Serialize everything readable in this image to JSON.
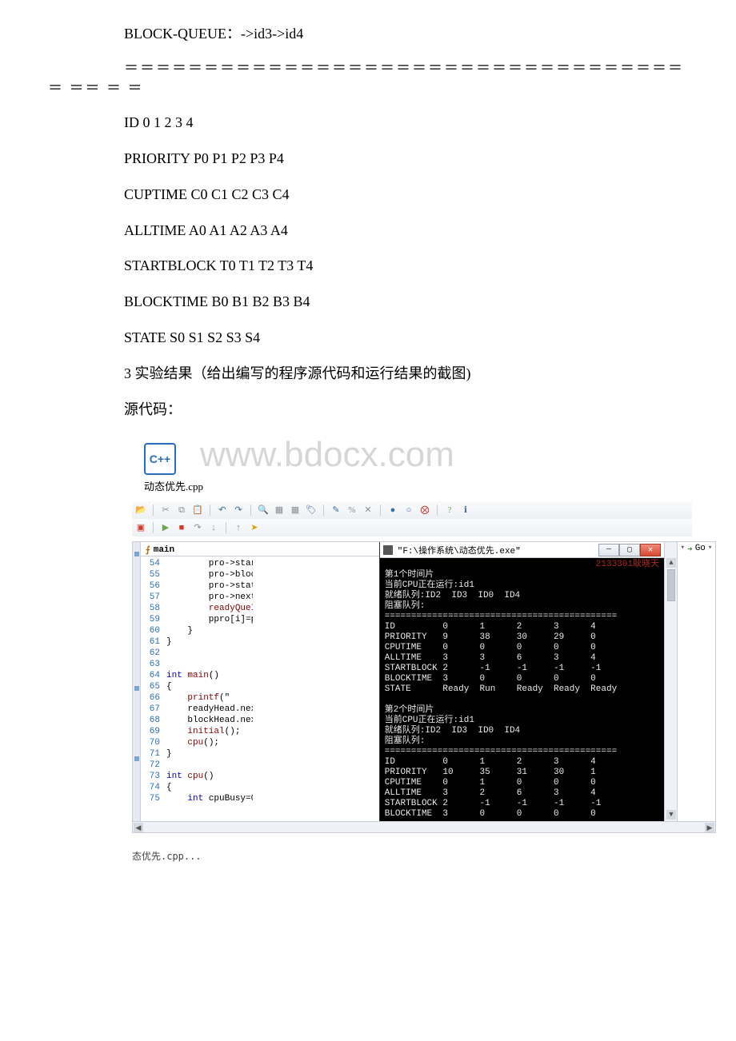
{
  "text": {
    "block_queue": "BLOCK-QUEUE：->id3->id4",
    "divider_head": "＝＝＝＝＝＝＝＝＝＝＝＝＝＝＝＝＝＝＝＝＝＝＝＝＝＝＝＝＝＝＝＝＝＝＝",
    "divider_tail": "＝ ＝＝ ＝ ＝",
    "id_row": "ID 0 1 2 3 4",
    "priority_row": "PRIORITY P0 P1 P2 P3 P4",
    "cuptime_row": "CUPTIME C0 C1 C2 C3 C4",
    "alltime_row": "ALLTIME A0 A1 A2 A3 A4",
    "startblock_row": "STARTBLOCK T0 T1 T2 T3 T4",
    "blocktime_row": "BLOCKTIME B0 B1 B2 B3 B4",
    "state_row": "STATE S0 S1 S2 S3 S4",
    "result_heading": "3 实验结果（给出编写的程序源代码和运行结果的截图)",
    "source_label": " 源代码：",
    "cpp_filename": "动态优先.cpp",
    "watermark": "www.bdocx.com",
    "footer_tab": "态优先.cpp..."
  },
  "ide": {
    "tab_label": "main",
    "go_label": "Go",
    "code": {
      "lines": [
        {
          "n": "54",
          "t": "        pro->star"
        },
        {
          "n": "55",
          "t": "        pro->bloc"
        },
        {
          "n": "56",
          "t": "        pro->stat"
        },
        {
          "n": "57",
          "t": "        pro->next"
        },
        {
          "n": "58",
          "t": "        readyQueI"
        },
        {
          "n": "59",
          "t": "        ppro[i]=p"
        },
        {
          "n": "60",
          "t": "    }"
        },
        {
          "n": "61",
          "t": "}"
        },
        {
          "n": "62",
          "t": ""
        },
        {
          "n": "63",
          "t": ""
        },
        {
          "n": "64",
          "t": "int main()"
        },
        {
          "n": "65",
          "t": "{"
        },
        {
          "n": "66",
          "t": "    printf(\""
        },
        {
          "n": "67",
          "t": "    readyHead.nex"
        },
        {
          "n": "68",
          "t": "    blockHead.nex"
        },
        {
          "n": "69",
          "t": "    initial();"
        },
        {
          "n": "70",
          "t": "    cpu();"
        },
        {
          "n": "71",
          "t": "}"
        },
        {
          "n": "72",
          "t": ""
        },
        {
          "n": "73",
          "t": "int cpu()"
        },
        {
          "n": "74",
          "t": "{"
        },
        {
          "n": "75",
          "t": "    int cpuBusy=0"
        }
      ]
    }
  },
  "console": {
    "title": "\"F:\\操作系统\\动态优先.exe\"",
    "student_id": "2133301耿晓天",
    "slice1": {
      "header": "第1个时间片",
      "running": "当前CPU正在运行:id1",
      "ready": "就绪队列:ID2  ID3  ID0  ID4",
      "block": "阻塞队列:",
      "sep": "============================================"
    },
    "slice2": {
      "header": "第2个时间片",
      "running": "当前CPU正在运行:id1",
      "ready": "就绪队列:ID2  ID3  ID0  ID4",
      "block": "阻塞队列:",
      "sep": "============================================"
    }
  },
  "chart_data": [
    {
      "type": "table",
      "title": "时间片1进程状态表",
      "columns": [
        "ID",
        "0",
        "1",
        "2",
        "3",
        "4"
      ],
      "rows": [
        [
          "PRIORITY",
          9,
          38,
          30,
          29,
          0
        ],
        [
          "CPUTIME",
          0,
          0,
          0,
          0,
          0
        ],
        [
          "ALLTIME",
          3,
          3,
          6,
          3,
          4
        ],
        [
          "STARTBLOCK",
          2,
          -1,
          -1,
          -1,
          -1
        ],
        [
          "BLOCKTIME",
          3,
          0,
          0,
          0,
          0
        ],
        [
          "STATE",
          "Ready",
          "Run",
          "Ready",
          "Ready",
          "Ready"
        ]
      ]
    },
    {
      "type": "table",
      "title": "时间片2进程状态表(partial)",
      "columns": [
        "ID",
        "0",
        "1",
        "2",
        "3",
        "4"
      ],
      "rows": [
        [
          "PRIORITY",
          10,
          35,
          31,
          30,
          1
        ],
        [
          "CPUTIME",
          0,
          1,
          0,
          0,
          0
        ],
        [
          "ALLTIME",
          3,
          2,
          6,
          3,
          4
        ],
        [
          "STARTBLOCK",
          2,
          -1,
          -1,
          -1,
          -1
        ],
        [
          "BLOCKTIME",
          3,
          0,
          0,
          0,
          0
        ]
      ]
    }
  ]
}
